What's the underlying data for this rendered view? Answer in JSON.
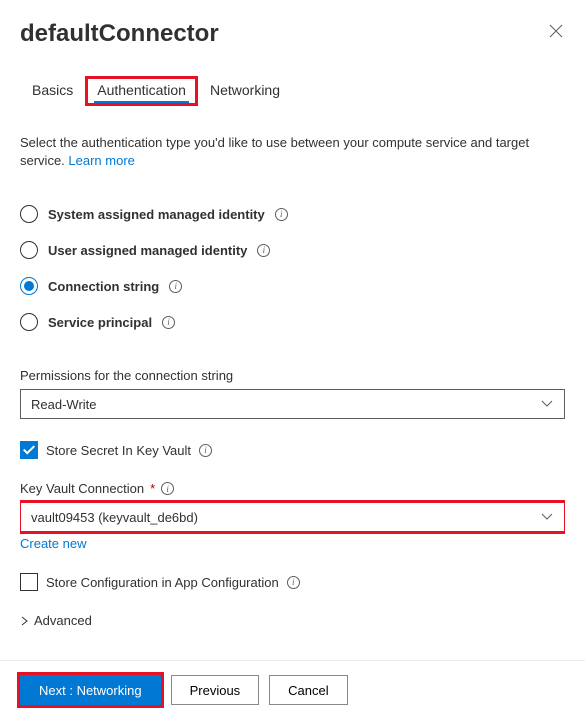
{
  "header": {
    "title": "defaultConnector"
  },
  "tabs": {
    "basics": "Basics",
    "authentication": "Authentication",
    "networking": "Networking"
  },
  "description": {
    "text": "Select the authentication type you'd like to use between your compute service and target service. ",
    "learn_more": "Learn more"
  },
  "auth_options": {
    "system_identity": "System assigned managed identity",
    "user_identity": "User assigned managed identity",
    "connection_string": "Connection string",
    "service_principal": "Service principal"
  },
  "permissions": {
    "label": "Permissions for the connection string",
    "value": "Read-Write"
  },
  "store_secret": {
    "label": "Store Secret In Key Vault"
  },
  "keyvault": {
    "label": "Key Vault Connection",
    "value": "vault09453 (keyvault_de6bd)",
    "create_new": "Create new"
  },
  "app_config": {
    "label": "Store Configuration in App Configuration"
  },
  "advanced": {
    "label": "Advanced"
  },
  "footer": {
    "next": "Next : Networking",
    "previous": "Previous",
    "cancel": "Cancel"
  }
}
